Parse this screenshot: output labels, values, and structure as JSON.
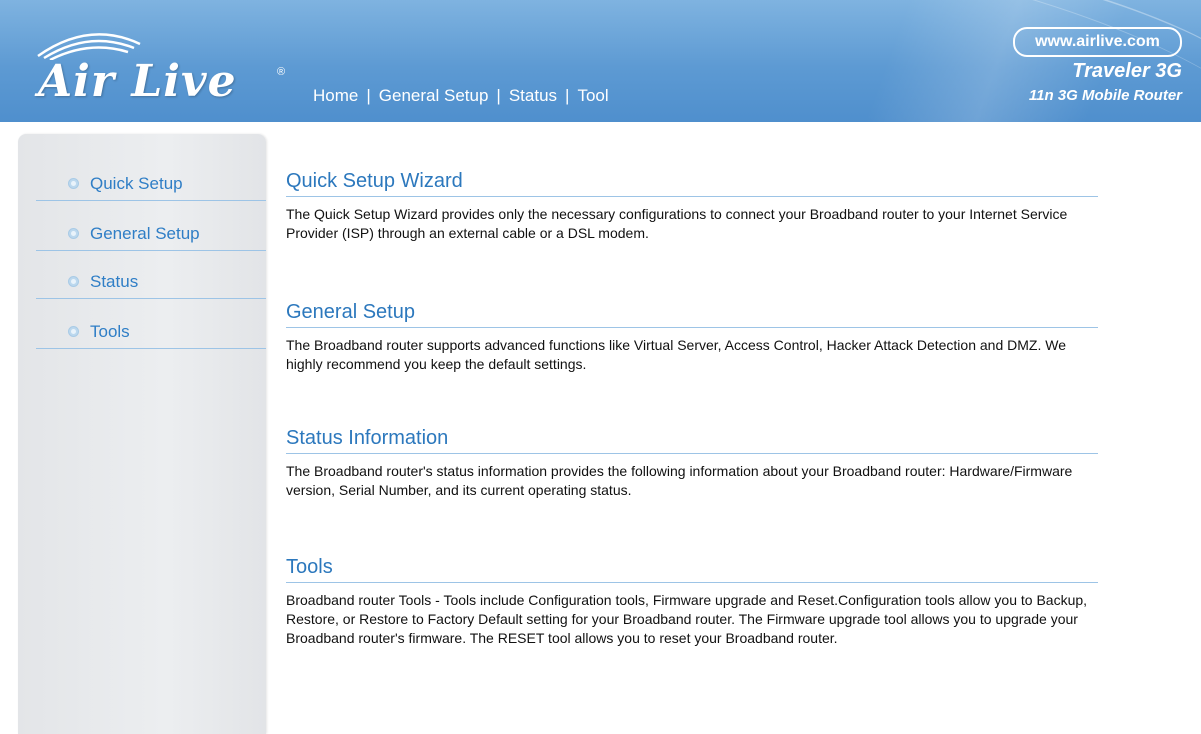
{
  "brand": {
    "logo_text": "Air Live",
    "logo_reg": "®",
    "url": "www.airlive.com",
    "product_name": "Traveler 3G",
    "product_sub": "11n 3G Mobile Router"
  },
  "topnav": {
    "items": [
      "Home",
      "General Setup",
      "Status",
      "Tool"
    ],
    "separator": "|"
  },
  "sidebar": {
    "items": [
      {
        "label": "Quick Setup"
      },
      {
        "label": "General Setup"
      },
      {
        "label": "Status"
      },
      {
        "label": "Tools"
      }
    ]
  },
  "sections": [
    {
      "title": "Quick Setup Wizard",
      "body": "The Quick Setup Wizard provides only the necessary configurations to connect your Broadband router to your Internet Service Provider (ISP) through an external cable or a DSL modem."
    },
    {
      "title": "General Setup",
      "body": "The Broadband router supports advanced functions like Virtual Server, Access Control, Hacker Attack Detection and DMZ. We highly recommend you keep the default settings."
    },
    {
      "title": "Status Information",
      "body": "The Broadband router's status information provides the following information about your Broadband router: Hardware/Firmware version, Serial Number, and its current operating status."
    },
    {
      "title": "Tools",
      "body": "Broadband router Tools - Tools include Configuration tools, Firmware upgrade and Reset.Configuration tools allow you to Backup, Restore, or Restore to Factory Default setting for your Broadband router. The Firmware upgrade tool allows you to upgrade your Broadband router's firmware. The RESET tool allows you to reset your Broadband router."
    }
  ],
  "colors": {
    "header_blue": "#5d9ad3",
    "link_blue": "#2f7ec6",
    "heading_blue": "#2c78bd",
    "sidebar_gray": "#eceef0"
  }
}
